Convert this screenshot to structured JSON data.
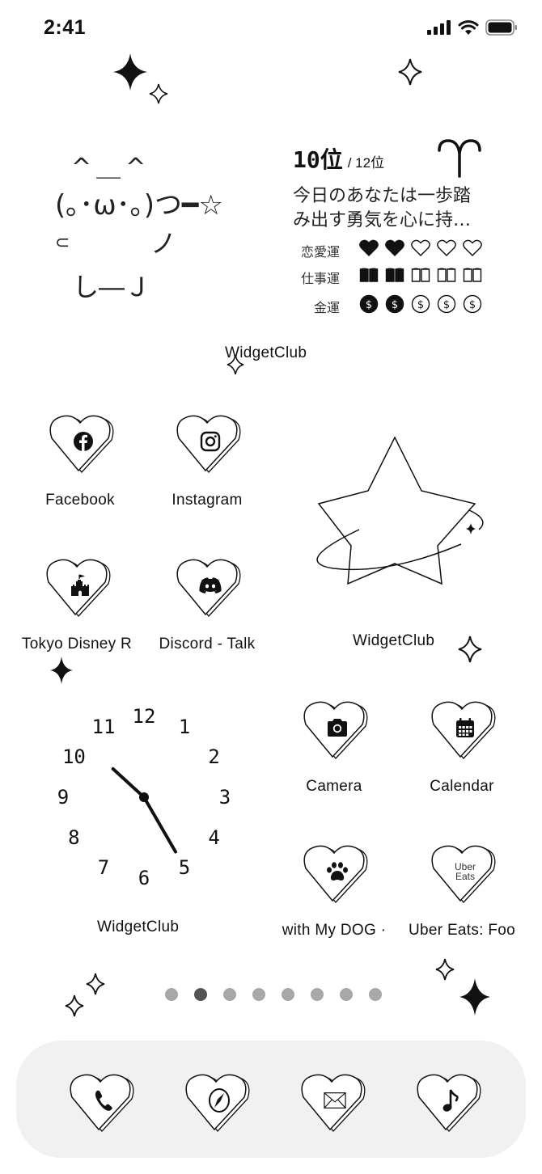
{
  "status_bar": {
    "time": "2:41",
    "signal_icon": "cellular-signal-icon",
    "wifi_icon": "wifi-icon",
    "battery_icon": "battery-full-icon"
  },
  "kaomoji": {
    "ears": "^＿^",
    "face": "(｡･ω･｡)つ━☆",
    "arms_left": "⊂",
    "arms_right": "ノ",
    "feet": "し―Ｊ"
  },
  "horoscope": {
    "rank": "10位",
    "rank_total": "/ 12位",
    "sign_icon": "aries-icon",
    "sign_glyph": "♈",
    "message_line1": "今日のあなたは一歩踏",
    "message_line2": "み出す勇気を心に持…",
    "fortunes": [
      {
        "label": "恋愛運",
        "icon": "heart-icon",
        "score": 2,
        "max": 5
      },
      {
        "label": "仕事運",
        "icon": "book-icon",
        "score": 2,
        "max": 5
      },
      {
        "label": "金運",
        "icon": "coin-icon",
        "score": 2,
        "max": 5
      }
    ],
    "widget_label": "WidgetClub"
  },
  "apps": [
    {
      "label": "Facebook",
      "icon": "facebook-icon"
    },
    {
      "label": "Instagram",
      "icon": "instagram-icon"
    },
    {
      "label": "Tokyo Disney R",
      "icon": "castle-icon"
    },
    {
      "label": "Discord - Talk",
      "icon": "discord-icon"
    },
    {
      "label": "Camera",
      "icon": "camera-icon"
    },
    {
      "label": "Calendar",
      "icon": "calendar-icon"
    },
    {
      "label": "with My DOG · ",
      "icon": "paw-icon"
    },
    {
      "label": "Uber Eats: Foo",
      "icon": "uber-eats-icon",
      "icon_text_1": "Uber",
      "icon_text_2": "Eats"
    }
  ],
  "star_widget": {
    "label": "WidgetClub",
    "icon": "orbit-star-icon"
  },
  "clock_widget": {
    "label": "WidgetClub",
    "numbers": [
      "12",
      "1",
      "2",
      "3",
      "4",
      "5",
      "6",
      "7",
      "8",
      "9",
      "10",
      "11"
    ],
    "hour": 10,
    "minute": 25
  },
  "page_dots": {
    "count": 8,
    "active_index": 1
  },
  "dock": [
    {
      "name": "phone",
      "icon": "phone-icon"
    },
    {
      "name": "safari",
      "icon": "compass-icon"
    },
    {
      "name": "mail",
      "icon": "mail-icon"
    },
    {
      "name": "music",
      "icon": "music-note-icon"
    }
  ]
}
